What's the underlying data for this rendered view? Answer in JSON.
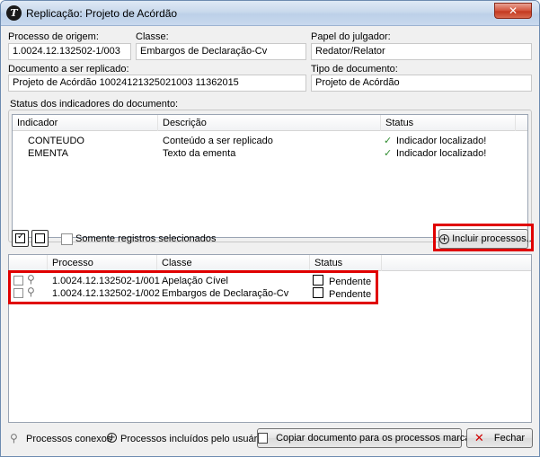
{
  "window": {
    "title": "Replicação: Projeto de Acórdão",
    "close_glyph": "✕",
    "logo_glyph": "T"
  },
  "form": {
    "processo_origem": {
      "label": "Processo de origem:",
      "value": "1.0024.12.132502-1/003"
    },
    "classe": {
      "label": "Classe:",
      "value": "Embargos de Declaração-Cv"
    },
    "papel_julgador": {
      "label": "Papel do julgador:",
      "value": "Redator/Relator"
    },
    "documento": {
      "label": "Documento a ser replicado:",
      "value": "Projeto de Acórdão 10024121325021003 11362015"
    },
    "tipo_documento": {
      "label": "Tipo de documento:",
      "value": "Projeto de Acórdão"
    }
  },
  "indicators": {
    "group_label": "Status dos indicadores do documento:",
    "columns": [
      "Indicador",
      "Descrição",
      "Status"
    ],
    "rows": [
      {
        "indicador": "CONTEUDO",
        "descricao": "Conteúdo a ser replicado",
        "status": "Indicador localizado!"
      },
      {
        "indicador": "EMENTA",
        "descricao": "Texto da ementa",
        "status": "Indicador localizado!"
      }
    ],
    "status_icon": "check-icon"
  },
  "toolbar": {
    "somente_label": "Somente registros selecionados",
    "incluir_label": "Incluir processos..."
  },
  "processes": {
    "columns": [
      "Processo",
      "Classe",
      "Status"
    ],
    "rows": [
      {
        "processo": "1.0024.12.132502-1/001",
        "classe": "Apelação Cível",
        "status": "Pendente"
      },
      {
        "processo": "1.0024.12.132502-1/002",
        "classe": "Embargos de Declaração-Cv",
        "status": "Pendente"
      }
    ]
  },
  "footer": {
    "legend_conexos": "Processos conexos",
    "legend_incluidos": "Processos incluídos pelo usuário",
    "copy_label": "Copiar documento para os processos marcados",
    "close_label": "Fechar"
  },
  "colors": {
    "highlight": "#e00000",
    "status_ok": "#2f8c2f"
  }
}
